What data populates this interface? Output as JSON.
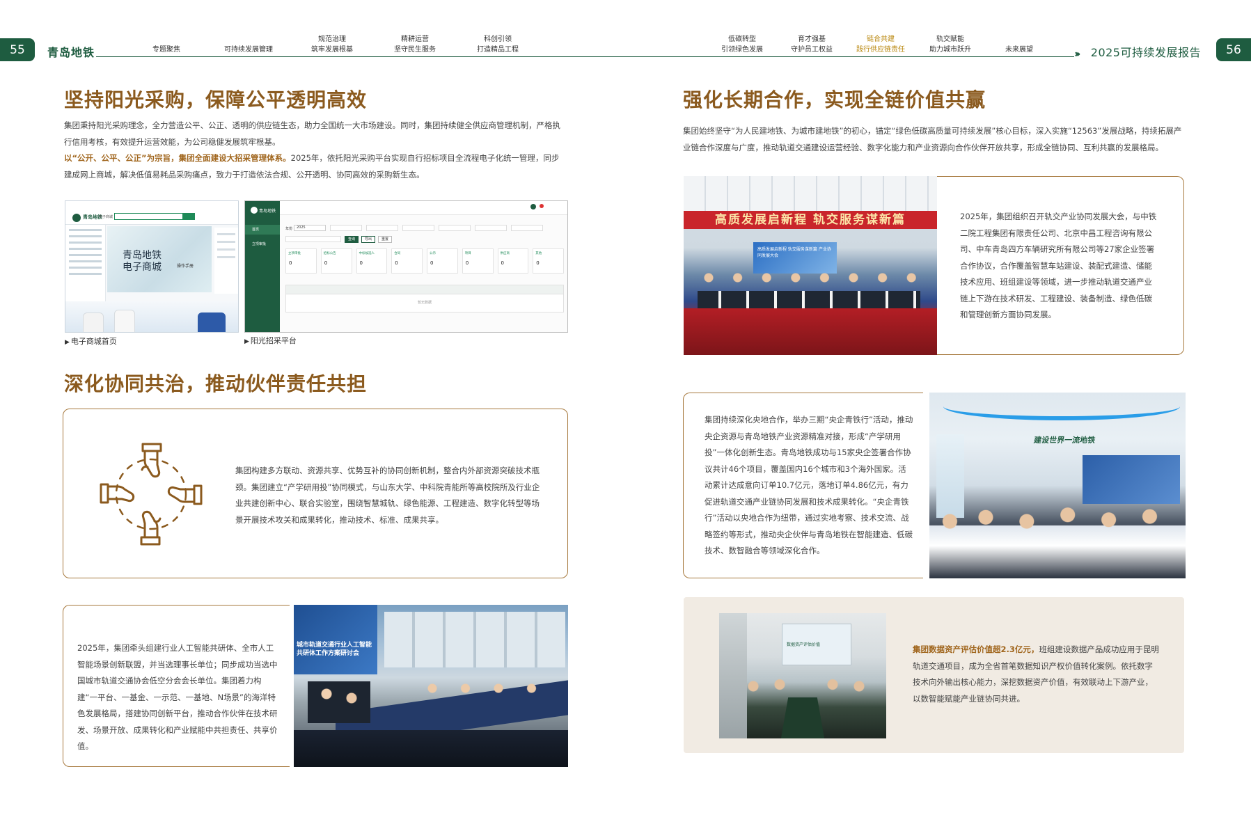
{
  "header": {
    "left_page": "55",
    "right_page": "56",
    "brand": "青岛地铁",
    "report": "2025可持续发展报告",
    "nav": [
      {
        "line1": "专题聚焦",
        "line2": ""
      },
      {
        "line1": "可持续发展管理",
        "line2": ""
      },
      {
        "line1": "规范治理",
        "line2": "筑牢发展根基"
      },
      {
        "line1": "精耕运营",
        "line2": "坚守民生服务"
      },
      {
        "line1": "科创引领",
        "line2": "打造精品工程"
      },
      {
        "line1": "低碳转型",
        "line2": "引领绿色发展"
      },
      {
        "line1": "育才强基",
        "line2": "守护员工权益"
      },
      {
        "line1": "链合共建",
        "line2": "践行供应链责任"
      },
      {
        "line1": "轨交赋能",
        "line2": "助力城市跃升"
      },
      {
        "line1": "未来展望",
        "line2": ""
      }
    ]
  },
  "left": {
    "sec1": {
      "title": "坚持阳光采购，保障公平透明高效",
      "p1": "集团秉持阳光采购理念，全力营造公平、公正、透明的供应链生态，助力全国统一大市场建设。同时，集团持续健全供应商管理机制，严格执行信用考核，有效提升运营效能，为公司稳健发展筑牢根基。",
      "p2_hl": "以“公开、公平、公正”为宗旨，集团全面建设大招采管理体系。",
      "p2_rest": "2025年，依托阳光采购平台实现自行招标项目全流程电子化统一管理，同步建成网上商城，解决低值易耗品采购痛点，致力于打造依法合规、公开透明、协同高效的采购新生态。",
      "caption1": "电子商城首页",
      "caption2": "阳光招采平台",
      "mall_logo": "青岛地铁",
      "mall_name": "电子商城",
      "mall_line1": "青岛地铁",
      "mall_line2": "电子商城",
      "mall_manual": "操作手册",
      "platform_logo": "青岛地铁",
      "platform_filter_label": "年份",
      "platform_year": "2025",
      "platform_menu1": "首页",
      "platform_menu2": "立项审批",
      "platform_buttons": [
        "查询",
        "导出",
        "重置"
      ],
      "platform_stat_labels": [
        "立项审批",
        "招标公告",
        "中标候选人",
        "合同",
        "公示",
        "项目",
        "供应商",
        "其他"
      ],
      "platform_stat_value": "0",
      "platform_no_data": "暂无数据"
    },
    "sec2": {
      "title": "深化协同共治，推动伙伴责任共担",
      "p1": "集团构建多方联动、资源共享、优势互补的协同创新机制，整合内外部资源突破技术瓶颈。集团建立“产学研用投”协同模式，与山东大学、中科院青能所等高校院所及行业企业共建创新中心、联合实验室，围绕智慧城轨、绿色能源、工程建造、数字化转型等场景开展技术攻关和成果转化，推动技术、标准、成果共享。",
      "p2": "2025年，集团牵头组建行业人工智能共研体、全市人工智能场景创新联盟，并当选理事长单位；同步成功当选中国城市轨道交通协会低空分会会长单位。集团着力构建“一平台、一基金、一示范、一基地、N场景”的海洋特色发展格局，搭建协同创新平台，推动合作伙伴在技术研发、场景开放、成果转化和产业赋能中共担责任、共享价值。",
      "photo_banner": "城市轨道交通行业人工智能共研体工作方案研讨会"
    }
  },
  "right": {
    "sec1": {
      "title": "强化长期合作，实现全链价值共赢",
      "p1": "集团始终坚守“为人民建地铁、为城市建地铁”的初心，锚定“绿色低碳高质量可持续发展”核心目标，深入实施“12563”发展战略，持续拓展产业链合作深度与广度，推动轨道交通建设运营经验、数字化能力和产业资源向合作伙伴开放共享，形成全链协同、互利共赢的发展格局。",
      "p2": "2025年，集团组织召开轨交产业协同发展大会，与中铁二院工程集团有限责任公司、北京中昌工程咨询有限公司、中车青岛四方车辆研究所有限公司等27家企业签署合作协议，合作覆盖智慧车站建设、装配式建造、储能技术应用、班组建设等领域，进一步推动轨道交通产业链上下游在技术研发、工程建设、装备制造、绿色低碳和管理创新方面协同发展。",
      "banner": "高质发展启新程  轨交服务谋新篇",
      "screen_text": "高质发展启新程  轨交服务谋新篇  产业协同发展大会"
    },
    "sec2": {
      "p1": "集团持续深化央地合作，举办三期“央企青铁行”活动，推动央企资源与青岛地铁产业资源精准对接，形成“产学研用投”一体化创新生态。青岛地铁成功与15家央企签署合作协议共计46个项目，覆盖国内16个城市和3个海外国家。活动累计达成意向订单10.7亿元，落地订单4.86亿元，有力促进轨道交通产业链协同发展和技术成果转化。“央企青铁行”活动以央地合作为纽带，通过实地考察、技术交流、战略签约等形式，推动央企伙伴与青岛地铁在智能建造、低碳技术、数智融合等领域深化合作。",
      "wall_text": "建设世界一流地铁"
    },
    "sec3": {
      "hl": "集团数据资产评估价值超2.3亿元，",
      "rest": "班组建设数据产品成功应用于昆明轨道交通项目，成为全省首笔数据知识产权价值转化案例。依托数字技术向外输出核心能力，深挖数据资产价值，有效联动上下游产业，以数智能赋能产业链协同共进。",
      "screen_text": "数据资产评估价值"
    }
  },
  "colors": {
    "green": "#1e5c40",
    "gold": "#8b5a1e",
    "border": "#a6783c",
    "beige": "#f1ebe3"
  }
}
